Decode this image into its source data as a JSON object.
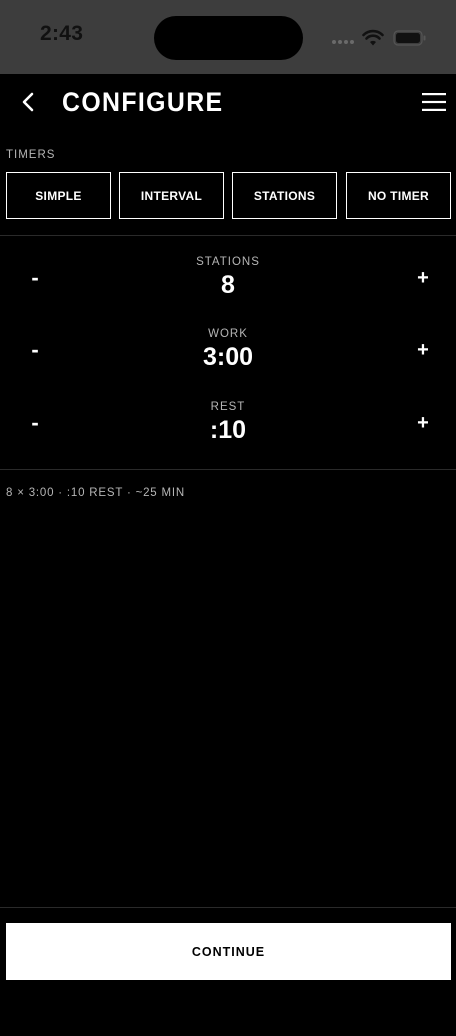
{
  "status_bar": {
    "time": "2:43"
  },
  "header": {
    "title": "CONFIGURE",
    "back_icon": "chevron-left-icon",
    "menu_icon": "hamburger-menu-icon"
  },
  "timers": {
    "label": "TIMERS",
    "options": [
      "SIMPLE",
      "INTERVAL",
      "STATIONS",
      "NO TIMER"
    ]
  },
  "steppers": [
    {
      "label": "STATIONS",
      "value": "8",
      "minus": "-",
      "plus": "+"
    },
    {
      "label": "WORK",
      "value": "3:00",
      "minus": "-",
      "plus": "+"
    },
    {
      "label": "REST",
      "value": ":10",
      "minus": "-",
      "plus": "+"
    }
  ],
  "summary": "8 × 3:00 · :10 REST · ~25 MIN",
  "continue_label": "CONTINUE"
}
